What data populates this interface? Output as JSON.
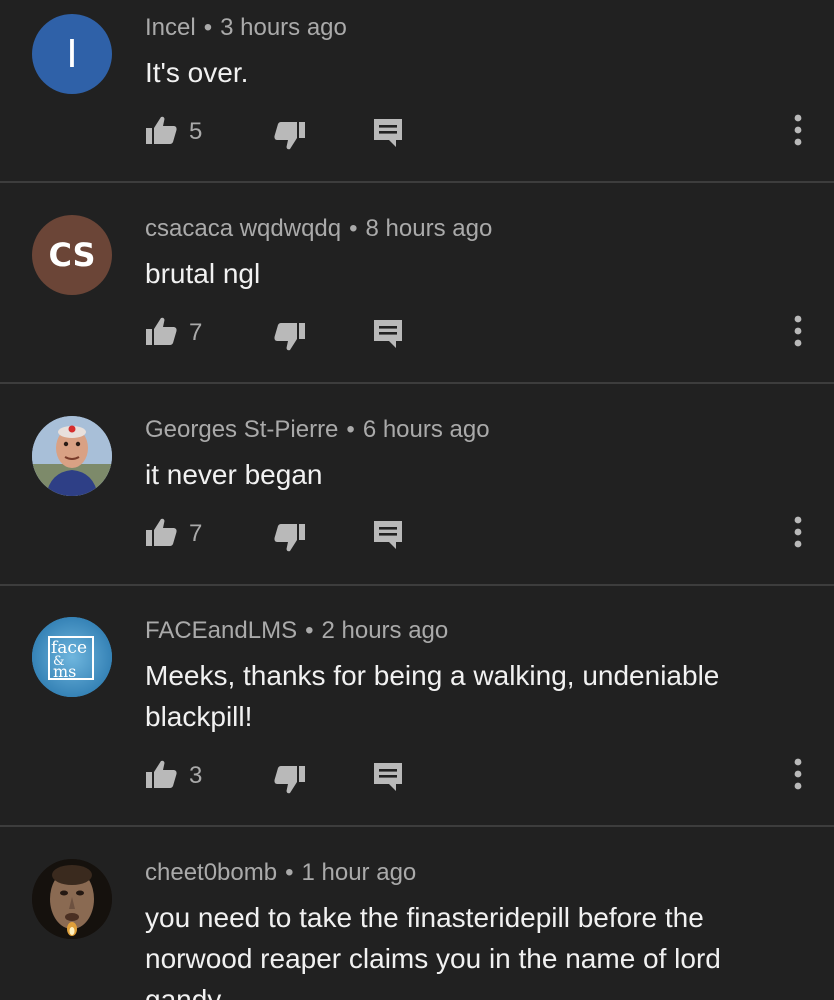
{
  "comments": [
    {
      "author": "Incel",
      "time": "3 hours ago",
      "text": "It's over.",
      "likes": "5",
      "avatar": {
        "type": "letter",
        "letters": "I",
        "bg": "#2f61a8"
      }
    },
    {
      "author": "csacaca wqdwqdq",
      "time": "8 hours ago",
      "text": "brutal ngl",
      "likes": "7",
      "avatar": {
        "type": "letter",
        "letters": "CS",
        "bg": "#6b4537"
      }
    },
    {
      "author": "Georges St-Pierre",
      "time": "6 hours ago",
      "text": "it never began",
      "likes": "7",
      "avatar": {
        "type": "image",
        "description": "cartoon-character"
      }
    },
    {
      "author": "FACEandLMS",
      "time": "2 hours ago",
      "text": "Meeks, thanks for being a walking, undeniable blackpill!",
      "likes": "3",
      "avatar": {
        "type": "logo",
        "logo_text": [
          "face",
          "&",
          "ms"
        ],
        "bg": "#3c8fc0"
      }
    },
    {
      "author": "cheet0bomb",
      "time": "1 hour ago",
      "text": "you need to take the finasteridepill before the norwood reaper claims you in the name of lord gandy",
      "likes": "",
      "avatar": {
        "type": "image",
        "description": "man-portrait"
      }
    }
  ],
  "separator": "•",
  "icons": {
    "like": "thumb-up-icon",
    "dislike": "thumb-down-icon",
    "reply": "reply-icon",
    "more": "more-vert-icon"
  },
  "colors": {
    "background": "#212121",
    "divider": "#3d3d3d",
    "text_primary": "#f1f1f1",
    "text_secondary": "#aaaaaa"
  }
}
